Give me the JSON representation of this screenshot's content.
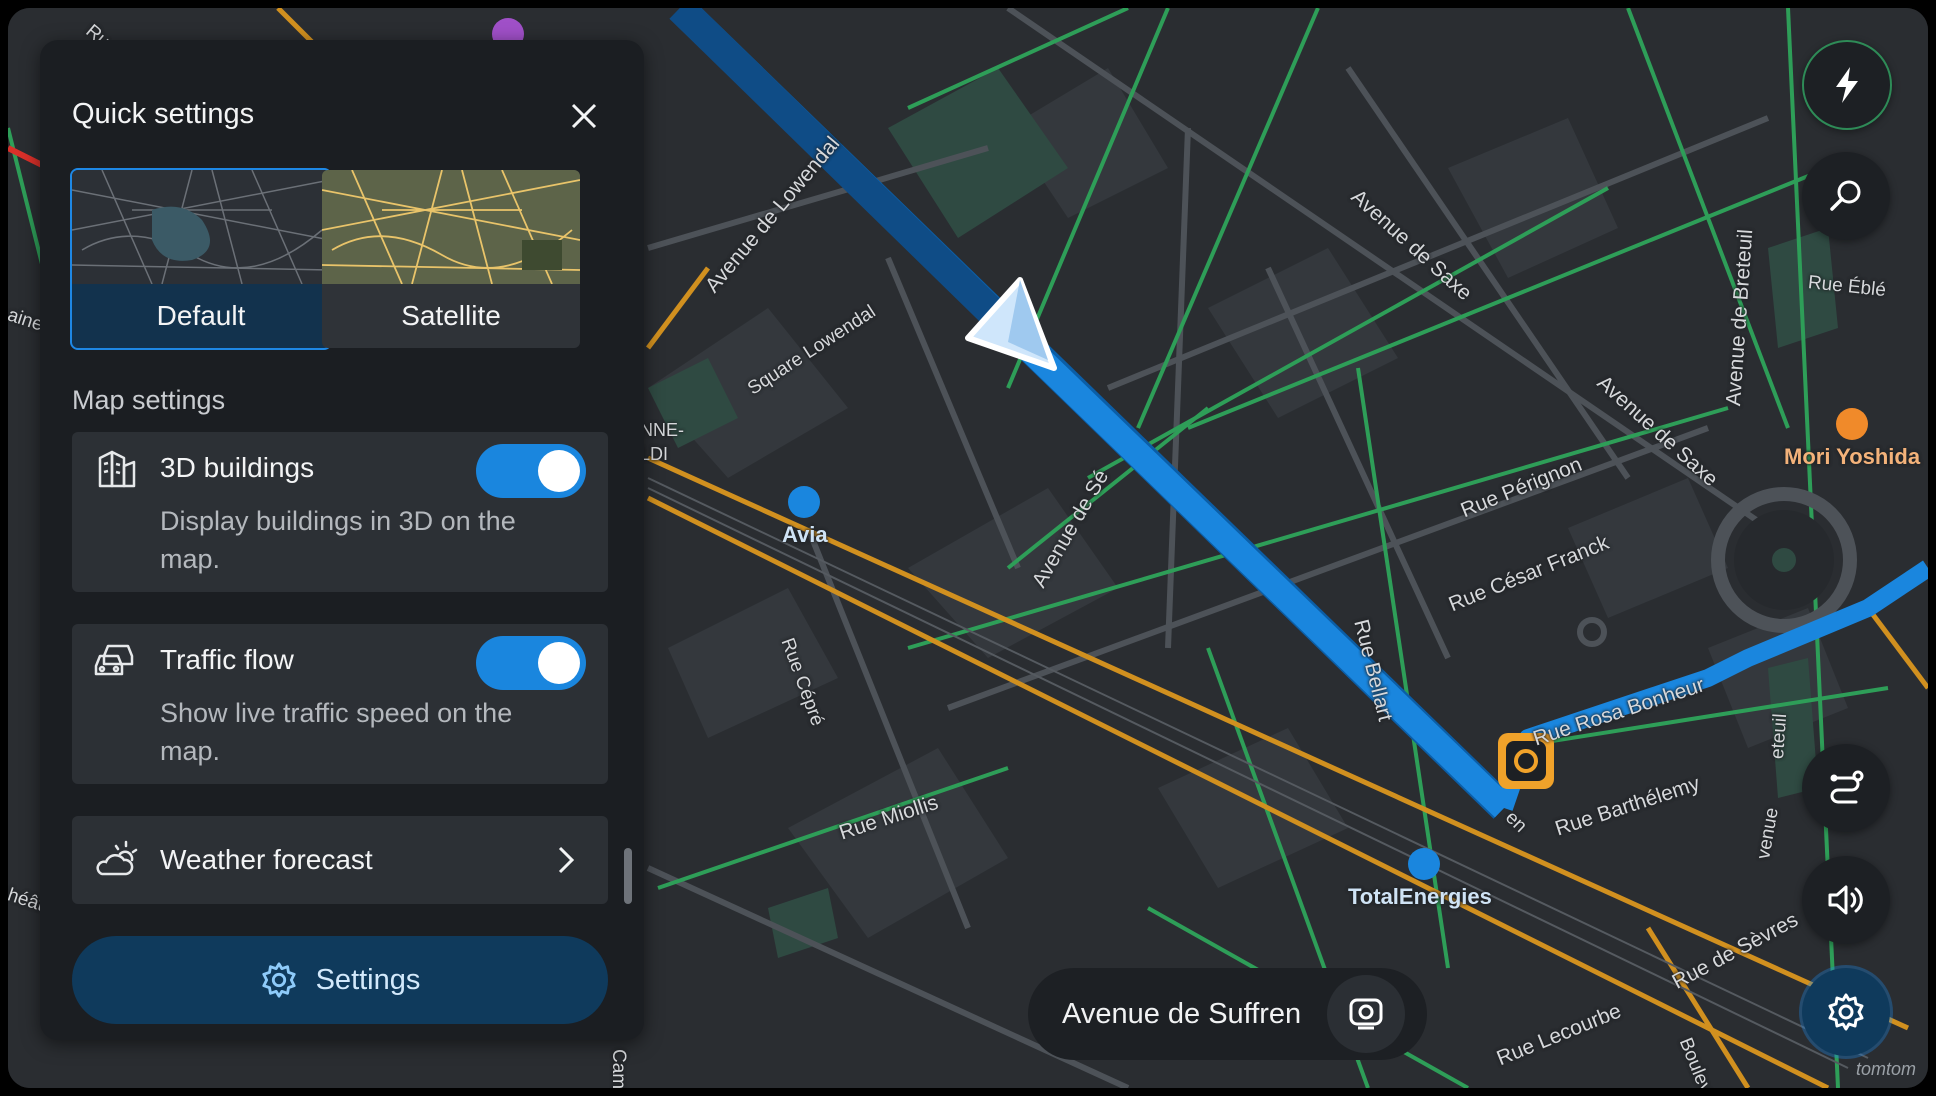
{
  "quick_settings": {
    "title": "Quick settings",
    "map_styles": [
      {
        "label": "Default",
        "selected": true
      },
      {
        "label": "Satellite",
        "selected": false
      }
    ],
    "map_settings_heading": "Map settings",
    "settings": [
      {
        "title": "3D buildings",
        "description": "Display buildings in 3D on the map.",
        "icon": "buildings-icon",
        "enabled": true
      },
      {
        "title": "Traffic flow",
        "description": "Show live traffic speed on the map.",
        "icon": "traffic-car-icon",
        "enabled": true
      }
    ],
    "weather": {
      "title": "Weather forecast",
      "icon": "weather-icon"
    },
    "settings_button": "Settings"
  },
  "map": {
    "street_labels": [
      "Avenue de Lowendal",
      "Square Lowendal",
      "Avenue de Saxe",
      "Avenue de Saxe",
      "Avenue de Breteuil",
      "Rue Éblé",
      "Avenue de Sé",
      "Rue Pérignon",
      "Rue César Franck",
      "Rue Bellart",
      "Rue Cépré",
      "Rue Miollis",
      "Rue Rosa Bonheur",
      "Rue Barthélemy",
      "Rue de Sèvres",
      "Rue Lecourbe",
      "Cambronne",
      "NNE-",
      "LDI",
      "aine",
      "héât",
      "Boulev",
      "eteuil",
      "venue",
      "en",
      "Ru"
    ],
    "pois": [
      {
        "label": "Avia",
        "icon": "fuel-icon"
      },
      {
        "label": "TotalEnergies",
        "icon": "fuel-icon"
      },
      {
        "label": "Mori Yoshida",
        "icon": "cafe-icon"
      }
    ],
    "current_street": "Avenue de Suffren",
    "route_color": "#1a86de",
    "brand": "tomtom"
  }
}
